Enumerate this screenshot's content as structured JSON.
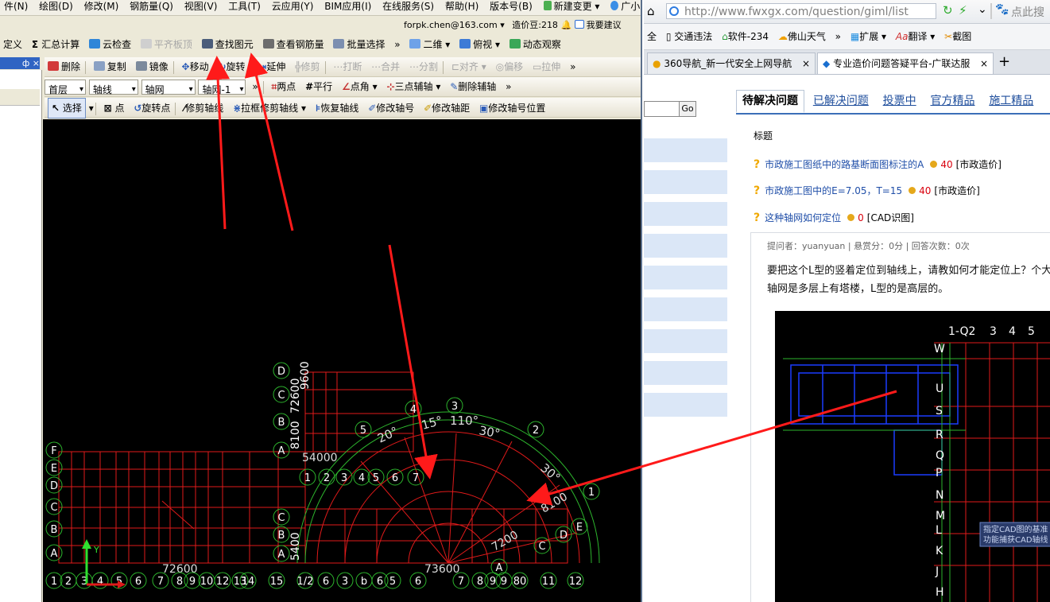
{
  "app": {
    "menu": [
      "件(N)",
      "绘图(D)",
      "修改(M)",
      "钢筋量(Q)",
      "视图(V)",
      "工具(T)",
      "云应用(Y)",
      "BIM应用(I)",
      "在线服务(S)",
      "帮助(H)",
      "版本号(B)",
      "新建变更",
      "广小二"
    ],
    "account": {
      "email": "forpk.chen@163.com",
      "bean": "造价豆:218",
      "suggest": "我要建议"
    },
    "toolbar1": [
      "定义",
      "汇总计算",
      "云检查",
      "平齐板顶",
      "查找图元",
      "查看钢筋量",
      "批量选择",
      "二维",
      "俯视",
      "动态观察"
    ],
    "toolbar2": [
      "删除",
      "复制",
      "镜像",
      "移动",
      "旋转",
      "延伸",
      "修剪",
      "打断",
      "合并",
      "分割",
      "对齐",
      "偏移",
      "拉伸"
    ],
    "toolbar3": {
      "floor": "首层",
      "type": "轴线",
      "sub": "轴网",
      "item": "轴网-1",
      "tools": [
        "两点",
        "平行",
        "点角",
        "三点辅轴",
        "删除辅轴"
      ]
    },
    "toolbar4": [
      "选择",
      "点",
      "旋转点",
      "修剪轴线",
      "拉框修剪轴线",
      "恢复轴线",
      "修改轴号",
      "修改轴距",
      "修改轴号位置"
    ],
    "panel_pin": "ф ×"
  },
  "drawing": {
    "row_letters_left": [
      "F",
      "E",
      "D",
      "C",
      "B",
      "A"
    ],
    "row_letters_mid": [
      "D",
      "C",
      "B",
      "A"
    ],
    "row_letters_low": [
      "C",
      "B",
      "A"
    ],
    "bottom_axis": [
      "1",
      "2",
      "3",
      "4",
      "5",
      "6",
      "7",
      "8",
      "9",
      "10",
      "12",
      "13",
      "14",
      "15",
      "1/2",
      "6",
      "3",
      "b",
      "6",
      "5",
      "6",
      "7",
      "8",
      "9",
      "9",
      "80",
      "11",
      "12"
    ],
    "arc_axis": [
      "1",
      "2",
      "3",
      "4",
      "5",
      "6",
      "7"
    ],
    "radial_axis": [
      "1",
      "2",
      "3",
      "4",
      "5"
    ],
    "angles": [
      "15°",
      "20°",
      "110°",
      "30°",
      "30°"
    ],
    "dims": [
      "54000",
      "73600",
      "72600",
      "7200",
      "5400",
      "8100",
      "9600"
    ],
    "right_labels": [
      "E",
      "D",
      "C",
      "A"
    ]
  },
  "browser": {
    "url": "http://www.fwxgx.com/question/giml/list",
    "search_hint": "点此搜",
    "bookmarks": [
      "全",
      "交通违法",
      "软件-234",
      "佛山天气",
      "»",
      "扩展",
      "翻译",
      "截图"
    ],
    "tabs": [
      "360导航_新一代安全上网导航",
      "专业造价问题答疑平台-广联达服"
    ],
    "go": "Go",
    "nav": [
      "待解决问题",
      "已解决问题",
      "投票中",
      "官方精品",
      "施工精品"
    ],
    "table_header": "标题",
    "questions": [
      {
        "title": "市政施工图纸中的路基断面图标注的A",
        "score": "40",
        "tag": "[市政造价]"
      },
      {
        "title": "市政施工图中的E=7.05，T=15",
        "score": "40",
        "tag": "[市政造价]"
      },
      {
        "title": "这种轴网如何定位",
        "score": "0",
        "tag": "[CAD识图]"
      }
    ],
    "meta": "提问者：yuanyuan  |  悬赏分：0分  |  回答次数：0次",
    "question_text": "要把这个L型的竖着定位到轴线上，请教如何才能定位上？个大轴网是多层上有塔楼，L型的是高层的。",
    "cad_letters": [
      "W",
      "U",
      "S",
      "R",
      "Q",
      "P",
      "N",
      "M",
      "L",
      "K",
      "J",
      "H"
    ],
    "cad_top_nums": [
      "1-Q2",
      "3",
      "4",
      "5"
    ],
    "cad_hint": "指定CAD图的基准 功能捕获CAD轴线"
  },
  "colors": {
    "accent": "#2f64c3",
    "arrow": "#ff1a1a",
    "grid_red": "#e01a1a",
    "grid_green": "#2db52d",
    "cad_blue": "#1a3cff"
  }
}
